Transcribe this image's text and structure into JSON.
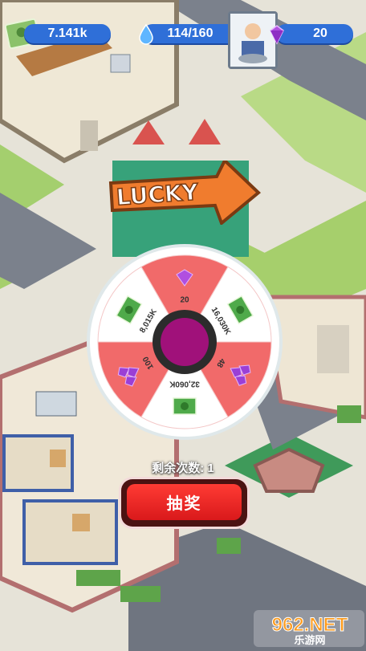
{
  "hud": {
    "cash": "7.141k",
    "water": "114/160",
    "gems": "20",
    "cash_icon": "cash-icon",
    "water_icon": "water-drop-icon",
    "gem_icon": "purple-gem-icon",
    "plus_icon": "plus-icon"
  },
  "banner": {
    "text": "LUCKY"
  },
  "wheel": {
    "segments": [
      {
        "reward": "gem",
        "label": "20",
        "color": "#f16a6a"
      },
      {
        "reward": "cash",
        "label": "16,030K",
        "color": "#ffffff"
      },
      {
        "reward": "gems-pile",
        "label": "48",
        "color": "#f16a6a"
      },
      {
        "reward": "cash",
        "label": "32,060K",
        "color": "#ffffff"
      },
      {
        "reward": "gems-pile",
        "label": "100",
        "color": "#f16a6a"
      },
      {
        "reward": "cash",
        "label": "8,015K",
        "color": "#ffffff"
      }
    ],
    "hub_color": "#a0117a"
  },
  "remaining": {
    "text": "剩余次数: 1"
  },
  "draw_button": {
    "label": "抽奖"
  },
  "watermark": {
    "text": "962.NET",
    "subtext": "乐游网"
  }
}
